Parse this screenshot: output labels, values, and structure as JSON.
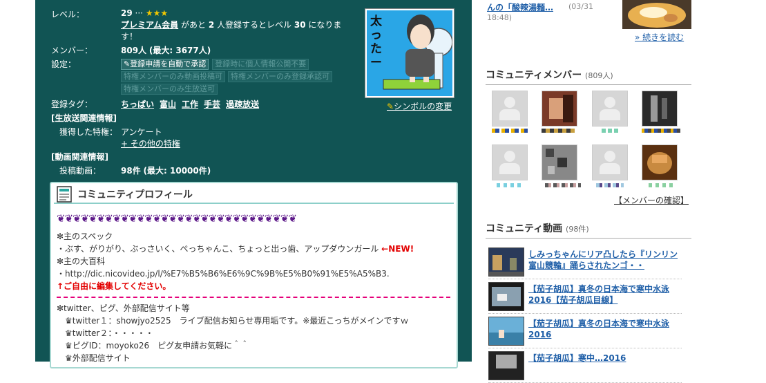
{
  "info": {
    "level_label": "レベル：",
    "level_value": "29",
    "level_sep": "···",
    "level_stars": "★★★",
    "premium_link": "プレミアム会員",
    "level_text_1": "があと",
    "level_num": "2",
    "level_text_2": "人登録するとレベル",
    "level_next": "30",
    "level_text_3": "になりま",
    "level_text_4": "す！",
    "members_label": "メンバー：",
    "members_value": "809人",
    "members_max": "(最大: 3677人)",
    "settings_label": "設定：",
    "settings_on": "登録申請を自動で承認",
    "settings_off": [
      "登録時に個人情報公開不要",
      "特権メンバーのみ動画投稿可",
      "特権メンバーのみ登録承認可",
      "特権メンバーのみ生放送可"
    ],
    "tags_label": "登録タグ：",
    "tags": [
      "ちっぱい",
      "富山",
      "工作",
      "手芸",
      "過疎放送"
    ],
    "symbol_change": "シンボルの変更",
    "symbol_text": "太ったー",
    "live_section": "[生放送関連情報]",
    "privilege_label": "獲得した特権：",
    "privilege_value": "アンケート",
    "privilege_more": "+ その他の特権",
    "video_section": "[動画関連情報]",
    "videos_label": "投稿動画：",
    "videos_value": "98件",
    "videos_max": "(最大: 10000件)"
  },
  "profile": {
    "title": "コミュニティプロフィール",
    "hearts": "❦❦❦❦❦❦❦❦❦❦❦❦❦❦❦❦❦❦❦❦❦❦❦❦❦❦❦❦❦❦",
    "spec_head": "✻主のスペック",
    "spec_line": "・ぶす、がりがり、ぶっさいく、ぺっちゃんこ、ちょっと出っ歯、アップダウンガール",
    "spec_new": "←NEW!",
    "wiki_head": "✻主の大百科",
    "wiki_url": "・http://dic.nicovideo.jp/l/%E7%B5%B6%E6%9C%9B%E5%B0%91%E5%A5%B3.",
    "wiki_edit": "↑ご自由に編集してください。",
    "sns_head": "✻twitter、ピグ、外部配信サイト等",
    "sns_lines": [
      "　♛twitter１：showjyo2525　ライブ配信お知らせ専用垢です。※最近こっちがメインですｗ",
      "　♛twitter２：・・・・・",
      "　♛ピグID：moyoko26　ピグ友申請お気軽に＾＾",
      "　♛外部配信サイト"
    ]
  },
  "sidebar": {
    "news_text": "んの「酸辣湯麺…",
    "news_date": "(03/31",
    "news_time": "18:48)",
    "read_more": "» 続きを読む",
    "members_title": "コミュニティメンバー",
    "members_count": "(809人)",
    "members_confirm": "【メンバーの確認】",
    "videos_title": "コミュニティ動画",
    "videos_count": "(98件)",
    "videos": [
      "しみっちゃんにリア凸したら『リンリン富山競輪』踊らされたンゴ・・",
      "【茄子胡瓜】真冬の日本海で寒中水泳2016【茄子胡瓜目線】",
      "【茄子胡瓜】真冬の日本海で寒中水泳2016",
      "【茄子胡瓜】寒中…2016"
    ]
  },
  "colors": {
    "bg_left": "#115454",
    "accent_red": "#e30000",
    "link": "#1e5ea7",
    "hearts": "#5e1a8a"
  }
}
